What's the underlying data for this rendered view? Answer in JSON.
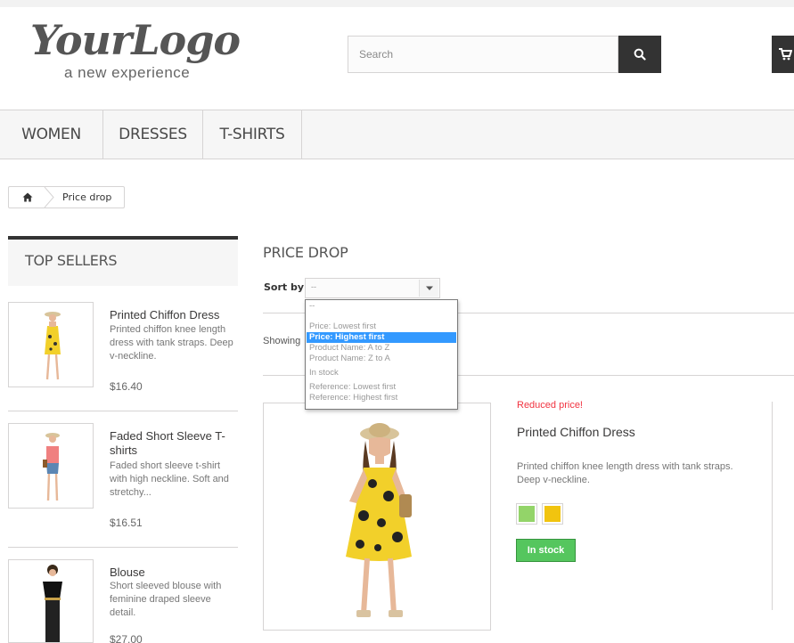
{
  "header": {
    "logo_main": "YourLogo",
    "logo_sub": "a new experience",
    "search_placeholder": "Search",
    "search_icon": "search-icon",
    "cart_icon": "cart-icon"
  },
  "menu": {
    "items": [
      {
        "label": "WOMEN"
      },
      {
        "label": "DRESSES"
      },
      {
        "label": "T-SHIRTS"
      }
    ]
  },
  "breadcrumb": {
    "home_icon": "home-icon",
    "current": "Price drop"
  },
  "sidebar": {
    "title": "TOP SELLERS",
    "items": [
      {
        "name": "Printed Chiffon Dress",
        "description": "Printed chiffon knee length dress with tank straps. Deep v-neckline.",
        "price": "$16.40"
      },
      {
        "name": "Faded Short Sleeve T-shirts",
        "description": "Faded short sleeve t-shirt with high neckline. Soft and stretchy...",
        "price": "$16.51"
      },
      {
        "name": "Blouse",
        "description": "Short sleeved blouse with feminine draped sleeve detail.",
        "price": "$27.00"
      }
    ]
  },
  "main": {
    "heading": "PRICE DROP",
    "sort_label": "Sort by",
    "sort_value": "--",
    "showing_text": "Showing",
    "sort_options": [
      "--",
      "Price: Lowest first",
      "Price: Highest first",
      "Product Name: A to Z",
      "Product Name: Z to A",
      "In stock",
      "Reference: Lowest first",
      "Reference: Highest first"
    ],
    "selected_option": "Price: Highest first"
  },
  "product": {
    "badge": "Reduced price!",
    "name": "Printed Chiffon Dress",
    "description": "Printed chiffon knee length dress with tank straps. Deep v-neckline.",
    "colors": [
      "#93d469",
      "#f1c40f"
    ],
    "availability": "In stock"
  }
}
